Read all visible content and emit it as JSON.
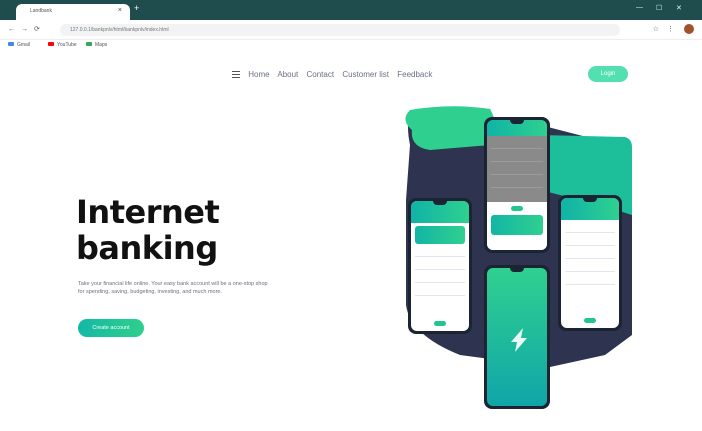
{
  "browser": {
    "tab_title": "Landbank",
    "tab_close": "×",
    "new_tab": "+",
    "url": "127.0.0.1/bankpnlv/html/bankpnlv/index.html",
    "bookmarks": [
      {
        "label": "Gmail",
        "color": "#4285f4"
      },
      {
        "label": "YouTube",
        "color": "#ff0000"
      },
      {
        "label": "Maps",
        "color": "#34a853"
      }
    ]
  },
  "nav": {
    "menu_icon": "menu-icon",
    "items": [
      "Home",
      "About",
      "Contact",
      "Customer list",
      "Feedback"
    ],
    "login_label": "Login"
  },
  "hero": {
    "title_line1": "Internet",
    "title_line2": "banking",
    "description": "Take your financial life online. Your easy bank account will be a one-stop shop for spending, saving, budgeting, investing, and much more.",
    "cta_label": "Create account"
  },
  "colors": {
    "accent": "#2fd08f",
    "accent_dark": "#10b3a7",
    "navy": "#2e3450",
    "text_muted": "#6a6f8a"
  }
}
